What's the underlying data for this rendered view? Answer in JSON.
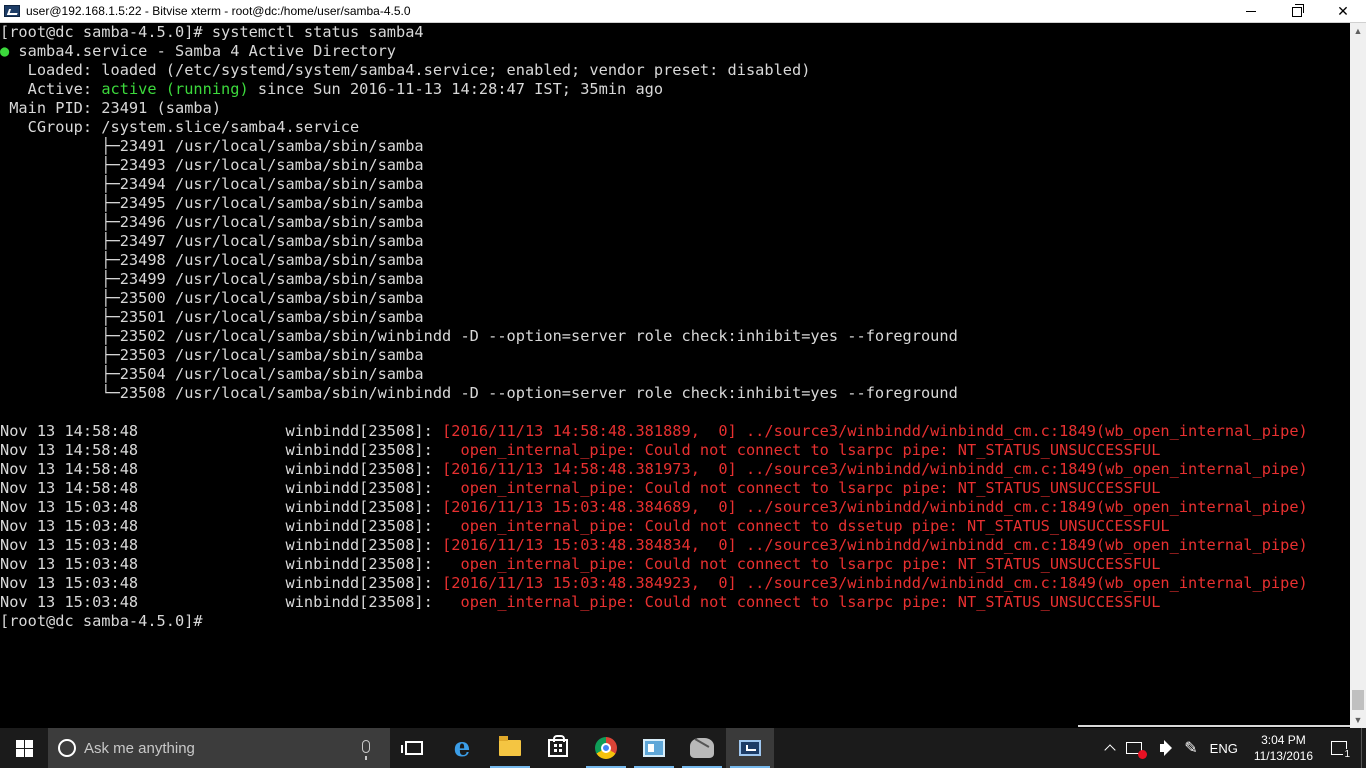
{
  "window": {
    "title": "user@192.168.1.5:22 - Bitvise xterm - root@dc:/home/user/samba-4.5.0",
    "minimize_label": "minimize",
    "maximize_label": "restore",
    "close_label": "✕"
  },
  "terminal": {
    "prompt_line": "[root@dc samba-4.5.0]# systemctl status samba4",
    "service_dot": "●",
    "service_line": " samba4.service - Samba 4 Active Directory",
    "loaded_line": "   Loaded: loaded (/etc/systemd/system/samba4.service; enabled; vendor preset: disabled)",
    "active_prefix": "   Active: ",
    "active_status": "active (running)",
    "active_suffix": " since Sun 2016-11-13 14:28:47 IST; 35min ago",
    "mainpid_line": " Main PID: 23491 (samba)",
    "cgroup_line": "   CGroup: /system.slice/samba4.service",
    "processes": [
      "           ├─23491 /usr/local/samba/sbin/samba",
      "           ├─23493 /usr/local/samba/sbin/samba",
      "           ├─23494 /usr/local/samba/sbin/samba",
      "           ├─23495 /usr/local/samba/sbin/samba",
      "           ├─23496 /usr/local/samba/sbin/samba",
      "           ├─23497 /usr/local/samba/sbin/samba",
      "           ├─23498 /usr/local/samba/sbin/samba",
      "           ├─23499 /usr/local/samba/sbin/samba",
      "           ├─23500 /usr/local/samba/sbin/samba",
      "           ├─23501 /usr/local/samba/sbin/samba",
      "           ├─23502 /usr/local/samba/sbin/winbindd -D --option=server role check:inhibit=yes --foreground",
      "           ├─23503 /usr/local/samba/sbin/samba",
      "           ├─23504 /usr/local/samba/sbin/samba",
      "           └─23508 /usr/local/samba/sbin/winbindd -D --option=server role check:inhibit=yes --foreground"
    ],
    "log_lines": [
      {
        "prefix": "Nov 13 14:58:48                winbindd[23508]: ",
        "message": "[2016/11/13 14:58:48.381889,  0] ../source3/winbindd/winbindd_cm.c:1849(wb_open_internal_pipe)"
      },
      {
        "prefix": "Nov 13 14:58:48                winbindd[23508]: ",
        "message": "  open_internal_pipe: Could not connect to lsarpc pipe: NT_STATUS_UNSUCCESSFUL"
      },
      {
        "prefix": "Nov 13 14:58:48                winbindd[23508]: ",
        "message": "[2016/11/13 14:58:48.381973,  0] ../source3/winbindd/winbindd_cm.c:1849(wb_open_internal_pipe)"
      },
      {
        "prefix": "Nov 13 14:58:48                winbindd[23508]: ",
        "message": "  open_internal_pipe: Could not connect to lsarpc pipe: NT_STATUS_UNSUCCESSFUL"
      },
      {
        "prefix": "Nov 13 15:03:48                winbindd[23508]: ",
        "message": "[2016/11/13 15:03:48.384689,  0] ../source3/winbindd/winbindd_cm.c:1849(wb_open_internal_pipe)"
      },
      {
        "prefix": "Nov 13 15:03:48                winbindd[23508]: ",
        "message": "  open_internal_pipe: Could not connect to dssetup pipe: NT_STATUS_UNSUCCESSFUL"
      },
      {
        "prefix": "Nov 13 15:03:48                winbindd[23508]: ",
        "message": "[2016/11/13 15:03:48.384834,  0] ../source3/winbindd/winbindd_cm.c:1849(wb_open_internal_pipe)"
      },
      {
        "prefix": "Nov 13 15:03:48                winbindd[23508]: ",
        "message": "  open_internal_pipe: Could not connect to lsarpc pipe: NT_STATUS_UNSUCCESSFUL"
      },
      {
        "prefix": "Nov 13 15:03:48                winbindd[23508]: ",
        "message": "[2016/11/13 15:03:48.384923,  0] ../source3/winbindd/winbindd_cm.c:1849(wb_open_internal_pipe)"
      },
      {
        "prefix": "Nov 13 15:03:48                winbindd[23508]: ",
        "message": "  open_internal_pipe: Could not connect to lsarpc pipe: NT_STATUS_UNSUCCESSFUL"
      }
    ],
    "final_prompt": "[root@dc samba-4.5.0]#",
    "colors": {
      "foreground": "#d8d8d8",
      "background": "#000000",
      "active_green": "#3cd93c",
      "error_red": "#e83030"
    }
  },
  "taskbar": {
    "search_placeholder": "Ask me anything",
    "apps": [
      {
        "icon": "task-view-icon"
      },
      {
        "icon": "edge-icon"
      },
      {
        "icon": "file-explorer-icon"
      },
      {
        "icon": "store-icon"
      },
      {
        "icon": "chrome-icon"
      },
      {
        "icon": "app-icon"
      },
      {
        "icon": "app-icon"
      },
      {
        "icon": "bitvise-xterm-icon"
      }
    ],
    "tray": {
      "language": "ENG",
      "time": "3:04 PM",
      "date": "11/13/2016",
      "notification_count": "1"
    }
  }
}
